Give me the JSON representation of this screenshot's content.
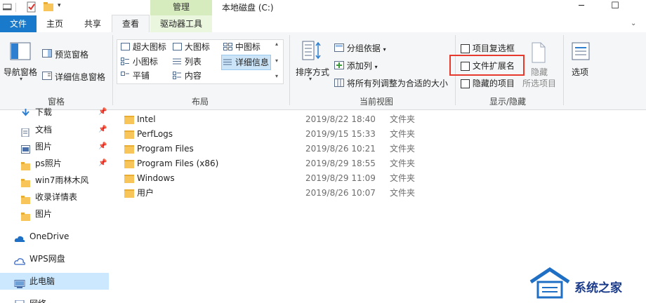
{
  "window": {
    "title": "本地磁盘 (C:)",
    "context_group": "管理"
  },
  "tabs": {
    "file": "文件",
    "home": "主页",
    "share": "共享",
    "view": "查看",
    "drive_tools": "驱动器工具"
  },
  "ribbon": {
    "panes": {
      "nav_pane": "导航窗格",
      "preview_pane": "预览窗格",
      "details_pane": "详细信息窗格",
      "group": "窗格"
    },
    "layout": {
      "extra_large": "超大图标",
      "large": "大图标",
      "medium": "中图标",
      "small": "小图标",
      "list": "列表",
      "details": "详细信息",
      "tiles": "平铺",
      "content": "内容",
      "group": "布局"
    },
    "current_view": {
      "sort_by": "排序方式",
      "group_by": "分组依据",
      "add_column": "添加列",
      "fit_columns": "将所有列调整为合适的大小",
      "group": "当前视图"
    },
    "show_hide": {
      "item_checkboxes": "项目复选框",
      "file_extensions": "文件扩展名",
      "hidden_items": "隐藏的项目",
      "hide_selected_a": "隐藏",
      "hide_selected_b": "所选项目",
      "options": "选项",
      "group": "显示/隐藏"
    }
  },
  "nav": {
    "items": [
      {
        "label": "下载",
        "pinned": true
      },
      {
        "label": "文档",
        "pinned": true
      },
      {
        "label": "图片",
        "pinned": true
      },
      {
        "label": "ps照片",
        "pinned": true
      },
      {
        "label": "win7雨林木风",
        "pinned": false
      },
      {
        "label": "收录详情表",
        "pinned": false
      },
      {
        "label": "图片",
        "pinned": false
      }
    ],
    "onedrive": "OneDrive",
    "wps": "WPS网盘",
    "this_pc": "此电脑",
    "network": "网络"
  },
  "files": [
    {
      "name": "Intel",
      "date": "2019/8/22 18:40",
      "type": "文件夹"
    },
    {
      "name": "PerfLogs",
      "date": "2019/9/15 15:33",
      "type": "文件夹"
    },
    {
      "name": "Program Files",
      "date": "2019/8/26 10:21",
      "type": "文件夹"
    },
    {
      "name": "Program Files (x86)",
      "date": "2019/8/29 18:55",
      "type": "文件夹"
    },
    {
      "name": "Windows",
      "date": "2019/8/29 11:09",
      "type": "文件夹"
    },
    {
      "name": "用户",
      "date": "2019/8/26 10:07",
      "type": "文件夹"
    }
  ],
  "watermark": {
    "text": "系统之家"
  },
  "colors": {
    "file_tab": "#1979ca",
    "context_tab": "#d6ecbe",
    "highlight": "#e8392f",
    "folder": "#f7c55a"
  }
}
